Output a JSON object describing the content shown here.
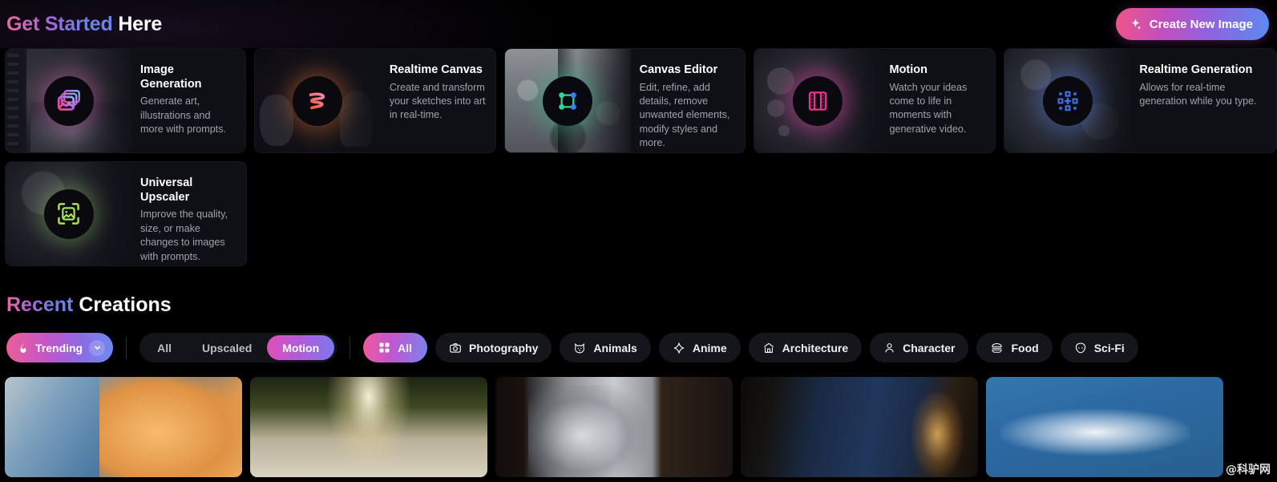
{
  "header": {
    "title_accent": "Get Started",
    "title_plain": "Here",
    "create_button": "Create New Image",
    "create_button_icon": "sparkles-icon"
  },
  "features": [
    {
      "title": "Image Generation",
      "desc": "Generate art, illustrations and more with prompts.",
      "icon": "image-stack-icon",
      "accent": "#d45cb4"
    },
    {
      "title": "Realtime Canvas",
      "desc": "Create and transform your sketches into art in real-time.",
      "icon": "squiggle-brush-icon",
      "accent": "#e2763c"
    },
    {
      "title": "Canvas Editor",
      "desc": "Edit, refine, add details, remove unwanted elements, modify styles and more.",
      "icon": "transform-nodes-icon",
      "accent": "#34c896"
    },
    {
      "title": "Motion",
      "desc": "Watch your ideas come to life in moments with generative video.",
      "icon": "film-strip-icon",
      "accent": "#e234a0"
    },
    {
      "title": "Realtime Generation",
      "desc": "Allows for real-time generation while you type.",
      "icon": "grid-plus-icon",
      "accent": "#3c64dc"
    },
    {
      "title": "Universal Upscaler",
      "desc": "Improve the quality, size, or make changes to images with prompts.",
      "icon": "upscale-image-icon",
      "accent": "#96dc5a"
    }
  ],
  "recent": {
    "title_accent": "Recent",
    "title_plain": "Creations",
    "sort": {
      "label": "Trending",
      "icon": "flame-icon",
      "chevron": "chevron-down-icon"
    },
    "segments": [
      {
        "label": "All",
        "active": false
      },
      {
        "label": "Upscaled",
        "active": false
      },
      {
        "label": "Motion",
        "active": true
      }
    ],
    "categories": [
      {
        "label": "All",
        "icon": "grid-icon",
        "active": true
      },
      {
        "label": "Photography",
        "icon": "camera-icon",
        "active": false
      },
      {
        "label": "Animals",
        "icon": "cat-icon",
        "active": false
      },
      {
        "label": "Anime",
        "icon": "sparkle-icon",
        "active": false
      },
      {
        "label": "Architecture",
        "icon": "building-icon",
        "active": false
      },
      {
        "label": "Character",
        "icon": "person-icon",
        "active": false
      },
      {
        "label": "Food",
        "icon": "burger-icon",
        "active": false
      },
      {
        "label": "Sci-Fi",
        "icon": "alien-icon",
        "active": false
      }
    ],
    "gallery": [
      {
        "alt": "Orange sunlit clouds against blue sky"
      },
      {
        "alt": "Sunlit country road through trees"
      },
      {
        "alt": "Dark window with grey storm clouds"
      },
      {
        "alt": "Night sky with stars above lit building"
      },
      {
        "alt": "White wispy clouds in blue sky"
      }
    ]
  },
  "watermark": "@科驴网"
}
